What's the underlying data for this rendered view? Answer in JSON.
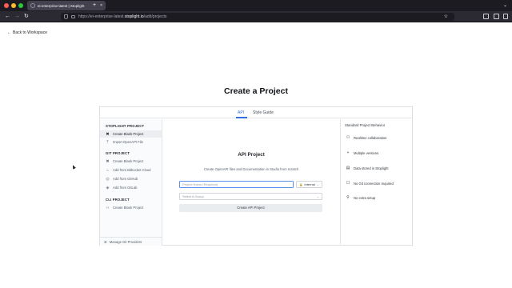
{
  "browser": {
    "tab_title": "ei-enterprise-latest | Stoplight",
    "tab_close": "×",
    "new_tab": "+",
    "tab_list": "⌄",
    "back": "←",
    "forward": "→",
    "reload": "↻",
    "url_prefix": "https://ei-enterprise-latest.",
    "url_domain": "stoplight.io",
    "url_path": "/add/projects",
    "bookmark": "☆",
    "colors": {
      "close": "#ff5f57",
      "minimize": "#febc2e",
      "zoom": "#28c840"
    }
  },
  "page": {
    "back_arrow": "←",
    "back_label": "Back to Workspace",
    "title": "Create a Project"
  },
  "tabs": [
    "API",
    "Style Guide"
  ],
  "sidebar": {
    "stoplight_heading": "STOPLIGHT PROJECT",
    "stoplight_items": [
      {
        "icon": "✖",
        "icon_name": "stoplight-icon",
        "label": "Create Blank Project",
        "active": true
      },
      {
        "icon": "⤒",
        "icon_name": "upload-icon",
        "label": "Import OpenAPI File"
      }
    ],
    "git_heading": "GIT PROJECT",
    "git_items": [
      {
        "icon": "✖",
        "icon_name": "stoplight-icon",
        "label": "Create Blank Project"
      },
      {
        "icon": "⌂",
        "icon_name": "bitbucket-icon",
        "label": "Add from Bitbucket Cloud"
      },
      {
        "icon": "◎",
        "icon_name": "github-icon",
        "label": "Add from GitHub"
      },
      {
        "icon": "◈",
        "icon_name": "gitlab-icon",
        "label": "Add from GitLab"
      }
    ],
    "cli_heading": "CLI PROJECT",
    "cli_items": [
      {
        "icon": "‹›",
        "icon_name": "code-icon",
        "label": "Create Blank Project"
      }
    ],
    "footer_icon": "⚙",
    "footer_label": "Manage Git Providers"
  },
  "main": {
    "heading": "API Project",
    "subtitle": "Create OpenAPI files and Documentation in Studio from scratch",
    "name_placeholder": "Project Name (Required)",
    "visibility_icon": "🔒",
    "visibility_value": "Internal",
    "group_placeholder": "Select A Group",
    "chevron": "⌄",
    "create_button": "Create API Project"
  },
  "behavior": {
    "heading": "Standard Project Behavior",
    "features": [
      {
        "icon": "⚇",
        "icon_name": "users-icon",
        "label": "Realtime collaboration"
      },
      {
        "icon": "⑂",
        "icon_name": "branch-icon",
        "label": "Multiple versions"
      },
      {
        "icon": "▤",
        "icon_name": "database-icon",
        "label": "Data stored in Stoplight"
      },
      {
        "icon": "☐",
        "icon_name": "checkbox-icon",
        "label": "No Git connection required"
      },
      {
        "icon": "⚲",
        "icon_name": "rocket-icon",
        "label": "No extra setup"
      }
    ]
  }
}
